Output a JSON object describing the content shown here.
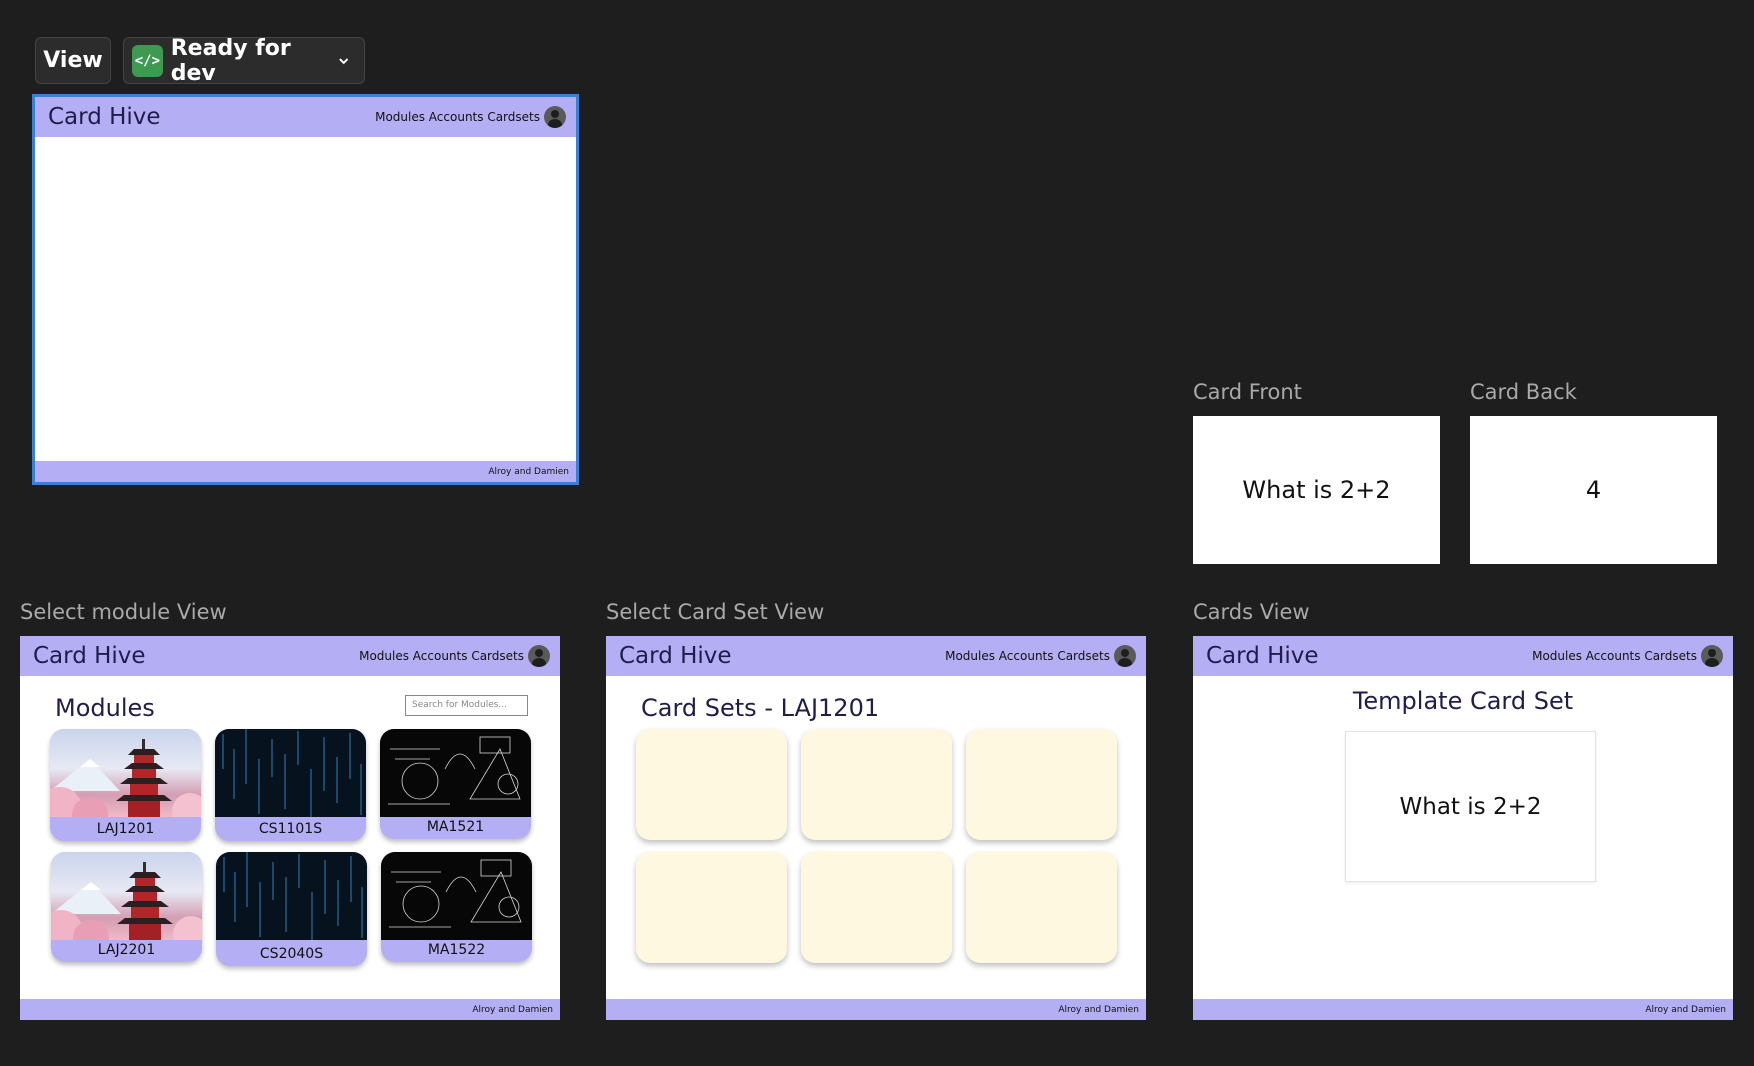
{
  "toolbar": {
    "view_label": "View",
    "status_label": "Ready for dev",
    "status_icon": "code-icon",
    "status_color": "#3d9a50"
  },
  "colors": {
    "canvas": "#1e1e1e",
    "header": "#b4aef5",
    "selection": "#3a7fd8",
    "card_set": "#fdf8df"
  },
  "app": {
    "title": "Card Hive",
    "nav": "Modules Accounts Cardsets",
    "footer": "Alroy and Damien"
  },
  "labels": {
    "card_front": "Card Front",
    "card_back": "Card Back",
    "select_module": "Select module View",
    "select_card_set": "Select Card Set View",
    "cards_view": "Cards View"
  },
  "flashcard": {
    "front": "What is 2+2",
    "back": "4"
  },
  "modules_view": {
    "heading": "Modules",
    "search_placeholder": "Search for Modules...",
    "modules": [
      {
        "code": "LAJ1201",
        "image": "japanese-pagoda"
      },
      {
        "code": "CS1101S",
        "image": "digital-code-rain"
      },
      {
        "code": "MA1521",
        "image": "math-chalkboard"
      },
      {
        "code": "LAJ2201",
        "image": "japanese-pagoda"
      },
      {
        "code": "CS2040S",
        "image": "digital-code-rain"
      },
      {
        "code": "MA1522",
        "image": "math-chalkboard"
      }
    ]
  },
  "card_set_view": {
    "heading": "Card Sets - LAJ1201",
    "card_set_count": 6
  },
  "cards_view": {
    "heading": "Template Card Set",
    "card_text": "What is 2+2"
  }
}
